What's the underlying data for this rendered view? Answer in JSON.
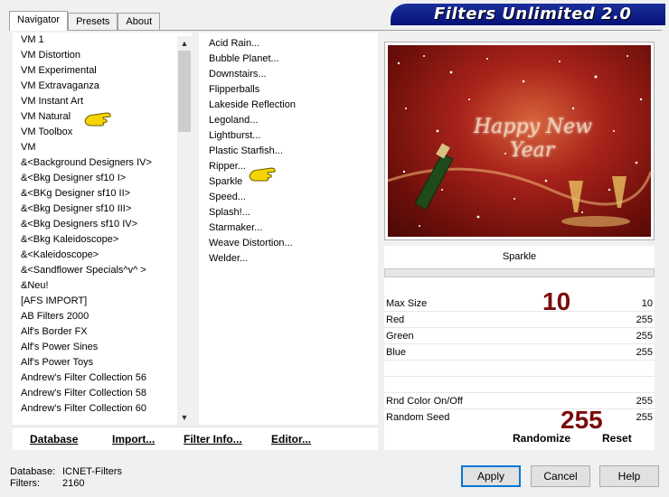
{
  "tabs": [
    {
      "label": "Navigator"
    },
    {
      "label": "Presets"
    },
    {
      "label": "About"
    }
  ],
  "banner_title": "Filters Unlimited 2.0",
  "categories": [
    "VM 1",
    "VM Distortion",
    "VM Experimental",
    "VM Extravaganza",
    "VM Instant Art",
    "VM Natural",
    "VM Toolbox",
    "VM",
    "&<Background Designers IV>",
    "&<Bkg Designer sf10 I>",
    "&<BKg Designer sf10 II>",
    "&<Bkg Designer sf10 III>",
    "&<Bkg Designers sf10 IV>",
    "&<Bkg Kaleidoscope>",
    "&<Kaleidoscope>",
    "&<Sandflower Specials^v^ >",
    "&Neu!",
    "[AFS IMPORT]",
    "AB Filters 2000",
    "Alf's Border FX",
    "Alf's Power Sines",
    "Alf's Power Toys",
    "Andrew's Filter Collection 56",
    "Andrew's Filter Collection 58",
    "Andrew's Filter Collection 60"
  ],
  "filters": [
    "Acid Rain...",
    "Bubble Planet...",
    "Downstairs...",
    "Flipperballs",
    "Lakeside Reflection",
    "Legoland...",
    "Lightburst...",
    "Plastic Starfish...",
    "Ripper...",
    "Sparkle",
    "Speed...",
    "Splash!...",
    "Starmaker...",
    "Weave Distortion...",
    "Welder..."
  ],
  "preview": {
    "greeting_line1": "Happy New",
    "greeting_line2": "Year"
  },
  "selected_filter": "Sparkle",
  "params": [
    {
      "label": "Max Size",
      "value": "10"
    },
    {
      "label": "Red",
      "value": "255"
    },
    {
      "label": "Green",
      "value": "255"
    },
    {
      "label": "Blue",
      "value": "255"
    }
  ],
  "params2": [
    {
      "label": "Rnd Color On/Off",
      "value": "255"
    },
    {
      "label": "Random Seed",
      "value": "255"
    }
  ],
  "callouts": {
    "max_size": "10",
    "random_seed": "255"
  },
  "bottom_buttons": {
    "database": "Database",
    "import": "Import...",
    "filter_info": "Filter Info...",
    "editor": "Editor...",
    "randomize": "Randomize",
    "reset": "Reset"
  },
  "status": {
    "database_label": "Database:",
    "database_value": "ICNET-Filters",
    "filters_label": "Filters:",
    "filters_value": "2160"
  },
  "dialog_buttons": {
    "apply": "Apply",
    "cancel": "Cancel",
    "help": "Help"
  },
  "colors": {
    "banner": "#0a1a8a",
    "callout": "#7b0c0c",
    "pointer": "#f5d400"
  }
}
